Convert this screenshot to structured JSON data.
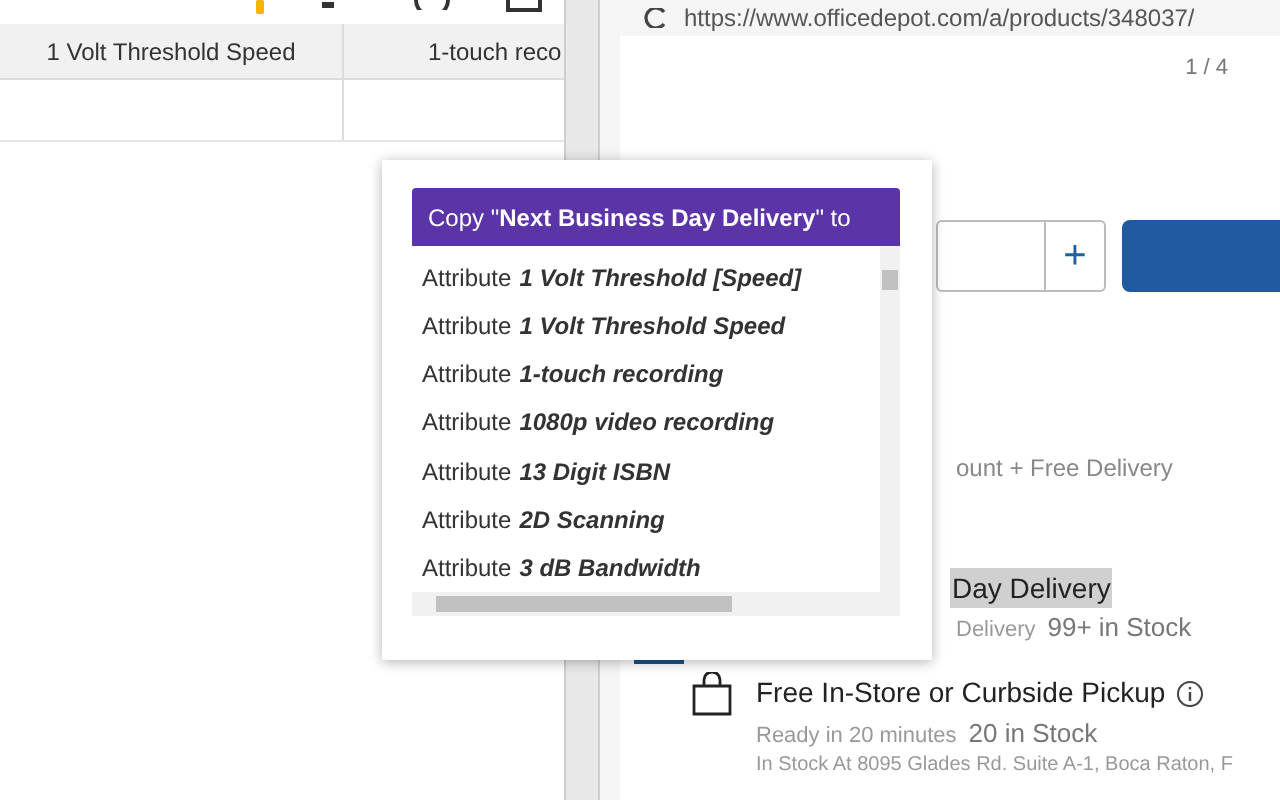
{
  "table": {
    "columns": [
      "1 Volt Threshold Speed",
      "1-touch reco"
    ]
  },
  "browser": {
    "url": "https://www.officedepot.com/a/products/348037/"
  },
  "page": {
    "image_counter": "1 / 4",
    "quantity_plus": "+",
    "shipping_note": "ount + Free Delivery",
    "delivery_title": "Day Delivery",
    "delivery_detail": "Delivery",
    "delivery_stock": "99+ in Stock",
    "pickup_title": "Free In-Store or Curbside Pickup",
    "pickup_ready": "Ready in 20 minutes",
    "pickup_stock": "20 in Stock",
    "pickup_address": "In Stock At 8095 Glades Rd. Suite A-1, Boca Raton, F"
  },
  "popup": {
    "title": "Copy \"**Next Business Day Delivery**\" to",
    "items": [
      {
        "prefix": "Attribute",
        "name": "1 Volt Threshold [Speed]"
      },
      {
        "prefix": "Attribute",
        "name": "1 Volt Threshold Speed"
      },
      {
        "prefix": "Attribute",
        "name": "1-touch recording"
      },
      {
        "prefix": "Attribute",
        "name": "1080p video recording"
      },
      {
        "prefix": "Attribute",
        "name": "13 Digit ISBN"
      },
      {
        "prefix": "Attribute",
        "name": "2D Scanning"
      },
      {
        "prefix": "Attribute",
        "name": "3 dB Bandwidth"
      }
    ]
  }
}
